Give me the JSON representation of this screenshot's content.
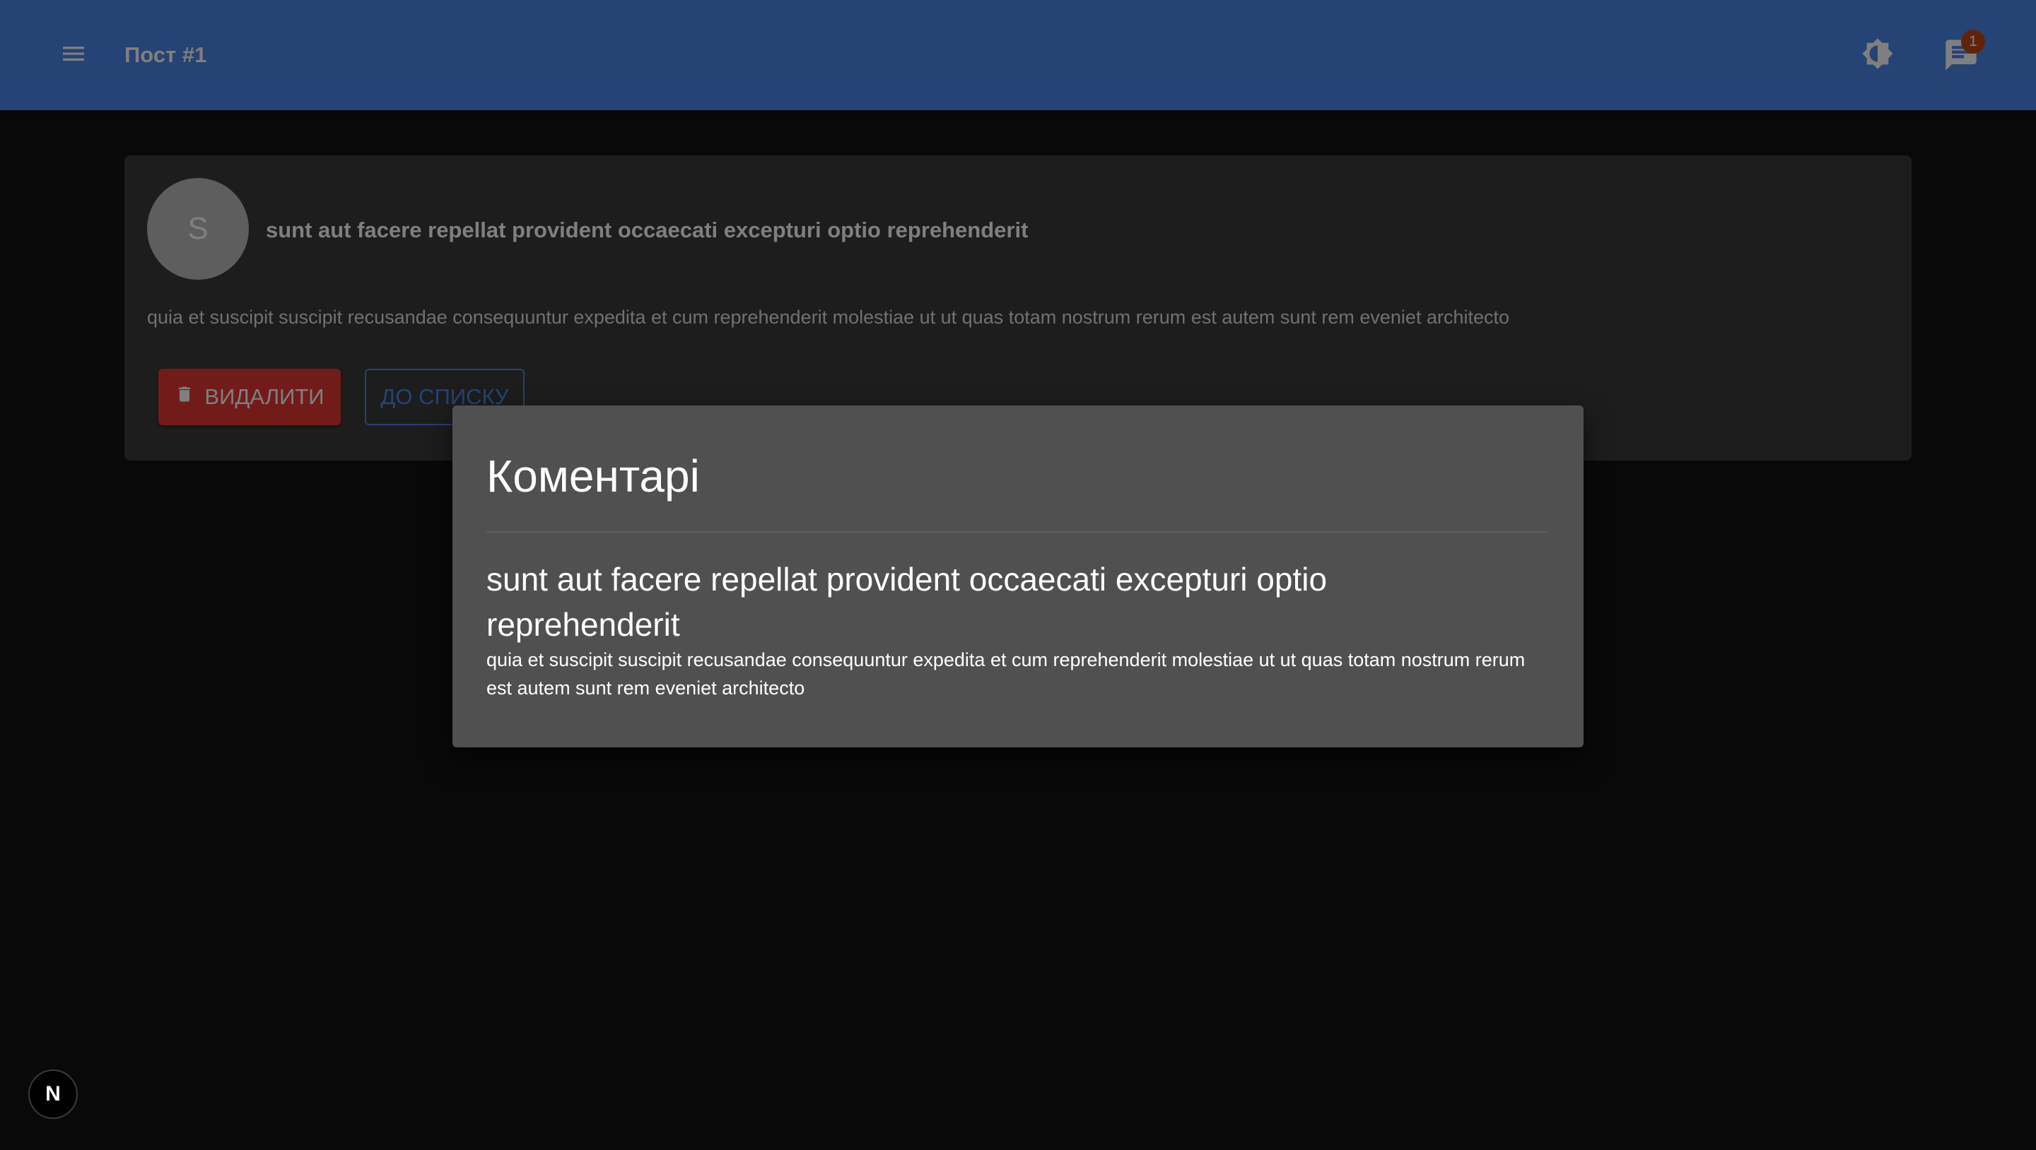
{
  "appbar": {
    "title": "Пост #1",
    "notification_count": "1",
    "icons": {
      "menu": "menu-icon",
      "theme": "brightness-icon",
      "comments": "chat-icon"
    },
    "color": "#4a86e8"
  },
  "post": {
    "avatar_letter": "S",
    "title": "sunt aut facere repellat provident occaecati excepturi optio reprehenderit",
    "body": "quia et suscipit suscipit recusandae consequuntur expedita et cum reprehenderit molestiae ut ut quas totam nostrum rerum est autem sunt rem eveniet architecto",
    "delete_label": "ВИДАЛИТИ",
    "back_label": "ДО СПИСКУ",
    "delete_color": "#e53935"
  },
  "dialog": {
    "title": "Коментарі",
    "comment": {
      "title": "sunt aut facere repellat provident occaecati excepturi optio reprehenderit",
      "body": "quia et suscipit suscipit recusandae consequuntur expedita et cum reprehenderit molestiae ut ut quas totam nostrum rerum est autem sunt rem eveniet architecto"
    }
  },
  "next_badge": {
    "letter": "N"
  }
}
